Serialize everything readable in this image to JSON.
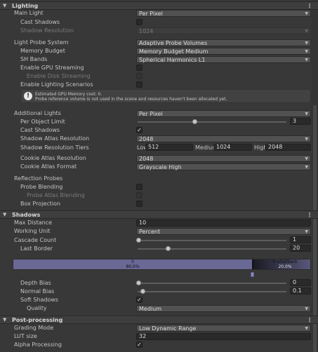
{
  "sections": {
    "lighting": {
      "title": "Lighting",
      "menu": "⋮"
    },
    "shadows": {
      "title": "Shadows",
      "menu": "⋮"
    },
    "post": {
      "title": "Post-processing",
      "menu": "⋮"
    }
  },
  "lighting": {
    "main_light": {
      "label": "Main Light",
      "value": "Per Pixel"
    },
    "cast_shadows": {
      "label": "Cast Shadows",
      "checked": false
    },
    "shadow_resolution": {
      "label": "Shadow Resolution",
      "value": "1024"
    },
    "probe_system": {
      "label": "Light Probe System",
      "value": "Adaptive Probe Volumes"
    },
    "memory_budget": {
      "label": "Memory Budget",
      "value": "Memory Budget Medium"
    },
    "sh_bands": {
      "label": "SH Bands",
      "value": "Spherical Harmonics L1"
    },
    "gpu_streaming": {
      "label": "Enable GPU Streaming",
      "checked": false
    },
    "disk_streaming": {
      "label": "Enable Disk Streaming",
      "checked": false
    },
    "lighting_scenarios": {
      "label": "Enable Lighting Scenarios",
      "checked": false
    },
    "help": {
      "line1": "Estimated GPU Memory cost: 0.",
      "line2": "Probe reference volume is not used in the scene and resources haven't been allocated yet."
    },
    "additional_lights": {
      "label": "Additional Lights",
      "value": "Per Pixel"
    },
    "per_object_limit": {
      "label": "Per Object Limit",
      "value": "3",
      "fraction": 0.5
    },
    "add_cast_shadows": {
      "label": "Cast Shadows",
      "checked": true
    },
    "atlas_resolution": {
      "label": "Shadow Atlas Resolution",
      "value": "2048"
    },
    "resolution_tiers": {
      "label": "Shadow Resolution Tiers",
      "tiers": [
        {
          "name": "Low",
          "value": "512"
        },
        {
          "name": "Medium",
          "value": "1024"
        },
        {
          "name": "High",
          "value": "2048"
        }
      ]
    },
    "cookie_atlas_resolution": {
      "label": "Cookie Atlas Resolution",
      "value": "2048"
    },
    "cookie_atlas_format": {
      "label": "Cookie Atlas Format",
      "value": "Grayscale High"
    },
    "reflection_probes": {
      "label": "Reflection Probes"
    },
    "probe_blending": {
      "label": "Probe Blending",
      "checked": false
    },
    "probe_atlas_blending": {
      "label": "Probe Atlas Blending",
      "checked": false
    },
    "box_projection": {
      "label": "Box Projection",
      "checked": false
    }
  },
  "shadows": {
    "max_distance": {
      "label": "Max Distance",
      "value": "10"
    },
    "working_unit": {
      "label": "Working Unit",
      "value": "Percent"
    },
    "cascade_count": {
      "label": "Cascade Count",
      "value": "1",
      "fraction": 0.0
    },
    "last_border": {
      "label": "Last Border",
      "value": "20",
      "fraction": 0.2
    },
    "cascade_bar": {
      "seg0_index": "0",
      "seg0_pct": "80,0%",
      "seg1_index": "0->Fallback",
      "seg1_pct": "20,0%"
    },
    "depth_bias": {
      "label": "Depth Bias",
      "value": "0",
      "fraction": 0.0
    },
    "normal_bias": {
      "label": "Normal Bias",
      "value": "0.1",
      "fraction": 0.033
    },
    "soft_shadows": {
      "label": "Soft Shadows",
      "checked": true
    },
    "quality": {
      "label": "Quality",
      "value": "Medium"
    }
  },
  "post": {
    "grading_mode": {
      "label": "Grading Mode",
      "value": "Low Dynamic Range"
    },
    "lut_size": {
      "label": "LUT size",
      "value": "32"
    },
    "alpha_processing": {
      "label": "Alpha Processing",
      "checked": true
    }
  },
  "colors": {
    "background": "#383838",
    "cascade0": "#6a6895",
    "cascade_fallback": "#58577a"
  }
}
